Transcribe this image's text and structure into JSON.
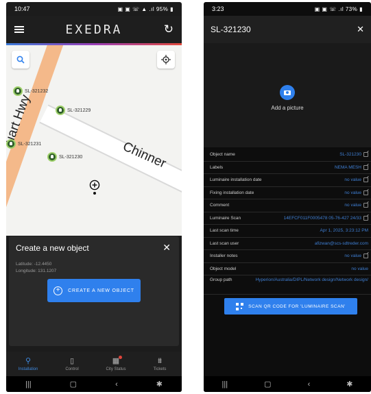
{
  "left": {
    "status": {
      "time": "10:47",
      "icons": "▣ ▣ ☏ ▲ .ıl 95% ▮"
    },
    "app": {
      "logo": "EXEDRA"
    },
    "map": {
      "markers": [
        {
          "label": "SL-321232"
        },
        {
          "label": "SL-321229"
        },
        {
          "label": "SL-321231"
        },
        {
          "label": "SL-321230"
        }
      ],
      "road_label_1": "Chinner",
      "road_label_2": "uart Hwy"
    },
    "dialog": {
      "title": "Create a new object",
      "latitude": "Latitude: -12.4450",
      "longitude": "Longitude: 131.1207",
      "button_label": "CREATE A NEW OBJECT"
    },
    "nav": [
      {
        "label": "Installation"
      },
      {
        "label": "Control"
      },
      {
        "label": "City Status"
      },
      {
        "label": "Tickets"
      }
    ]
  },
  "right": {
    "status": {
      "time": "3:23",
      "icons": "▣ ▣ ☏ .ıl 73% ▮"
    },
    "header": {
      "title": "SL-321230"
    },
    "add_picture": "Add a picture",
    "properties": [
      {
        "name": "Object name",
        "value": "SL-321230",
        "editable": true
      },
      {
        "name": "Labels",
        "value": "NEMA MESH",
        "editable": true
      },
      {
        "name": "Luminaire installation date",
        "value": "no value",
        "editable": true
      },
      {
        "name": "Fixing installation date",
        "value": "no value",
        "editable": true
      },
      {
        "name": "Comment",
        "value": "no value",
        "editable": true
      },
      {
        "name": "Luminaire Scan",
        "value": "14EFCF011F0005478 05-76-427 24/33",
        "editable": true
      },
      {
        "name": "Last scan time",
        "value": "Apr 1, 2025, 3:23:12 PM",
        "editable": false
      },
      {
        "name": "Last scan user",
        "value": "afizwan@scs-sdtreder.com",
        "editable": false
      },
      {
        "name": "Installer notes",
        "value": "no value",
        "editable": true
      },
      {
        "name": "Object model",
        "value": "no value",
        "editable": false
      },
      {
        "name": "Group path",
        "value": "Hyperion/Australia/DIPL/Network design/Network design/",
        "editable": false
      }
    ],
    "qr_button": "SCAN QR CODE FOR 'LUMINAIRE SCAN'"
  },
  "colors": {
    "accent": "#2f80ed",
    "marker": "#2f5d2a",
    "road": "#f4b98a"
  },
  "icons": [
    "hamburger-icon",
    "refresh-icon",
    "search-icon",
    "locate-icon",
    "marker-pin-icon",
    "crosshair-icon",
    "close-icon",
    "plus-circle-icon",
    "camera-icon",
    "edit-icon",
    "qr-code-icon"
  ]
}
